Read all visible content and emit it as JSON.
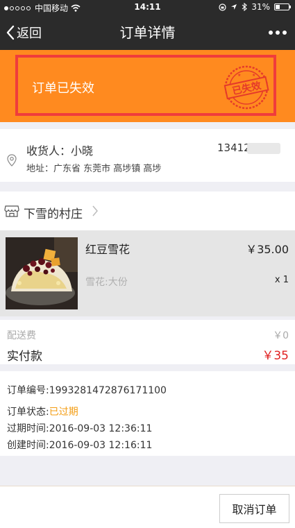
{
  "status_bar": {
    "carrier": "中国移动",
    "time": "14:11",
    "battery": "31%"
  },
  "nav": {
    "back_label": "返回",
    "title": "订单详情"
  },
  "banner": {
    "text": "订单已失效",
    "stamp_text": "已失效"
  },
  "address": {
    "receiver": "收货人：小晓",
    "phone": "134122",
    "address": "地址：广东省 东莞市 高埗镇 高埗"
  },
  "shop": {
    "name": "下雪的村庄"
  },
  "product": {
    "name": "红豆雪花",
    "price": "￥35.00",
    "spec": "雪花:大份",
    "qty": "x 1"
  },
  "fees": {
    "delivery_label": "配送费",
    "delivery_value": "￥0",
    "paid_label": "实付款",
    "paid_value": "￥35"
  },
  "order_info": {
    "number": "订单编号:1993281472876171100",
    "status_label": "订单状态:",
    "status_value": "已过期",
    "expire_time": "过期时间:2016-09-03 12:36:11",
    "create_time": "创建时间:2016-09-03 12:16:11"
  },
  "footer": {
    "cancel_label": "取消订单"
  },
  "colors": {
    "accent_orange": "#ff8a1f",
    "highlight_red": "#f03c3c",
    "price_red": "#e02020",
    "status_orange": "#f39c12",
    "nav_dark": "#2b2b2b"
  }
}
